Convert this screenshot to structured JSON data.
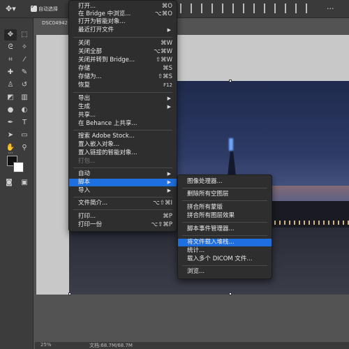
{
  "options_bar": {
    "auto_select_label": "自动选择"
  },
  "document": {
    "tab_title": "DSC04942"
  },
  "status": {
    "zoom": "25%",
    "doc_size": "文档:68.7M/68.7M"
  },
  "file_menu": {
    "items": [
      {
        "label": "打开...",
        "shortcut": "⌘O"
      },
      {
        "label": "在 Bridge 中浏览...",
        "shortcut": "⌥⌘O"
      },
      {
        "label": "打开为智能对象...",
        "shortcut": ""
      },
      {
        "label": "最近打开文件",
        "shortcut": ""
      },
      {
        "label": "关闭",
        "shortcut": "⌘W"
      },
      {
        "label": "关闭全部",
        "shortcut": "⌥⌘W"
      },
      {
        "label": "关闭并转到 Bridge...",
        "shortcut": "⇧⌘W"
      },
      {
        "label": "存储",
        "shortcut": "⌘S"
      },
      {
        "label": "存储为...",
        "shortcut": "⇧⌘S"
      },
      {
        "label": "恢复",
        "shortcut": "F12"
      },
      {
        "label": "导出",
        "shortcut": ""
      },
      {
        "label": "生成",
        "shortcut": ""
      },
      {
        "label": "共享...",
        "shortcut": ""
      },
      {
        "label": "在 Behance 上共享...",
        "shortcut": ""
      },
      {
        "label": "搜索 Adobe Stock...",
        "shortcut": ""
      },
      {
        "label": "置入嵌入对象...",
        "shortcut": ""
      },
      {
        "label": "置入链接的智能对象...",
        "shortcut": ""
      },
      {
        "label": "打包...",
        "shortcut": ""
      },
      {
        "label": "自动",
        "shortcut": ""
      },
      {
        "label": "脚本",
        "shortcut": ""
      },
      {
        "label": "导入",
        "shortcut": ""
      },
      {
        "label": "文件简介...",
        "shortcut": "⌥⇧⌘I"
      },
      {
        "label": "打印...",
        "shortcut": "⌘P"
      },
      {
        "label": "打印一份",
        "shortcut": "⌥⇧⌘P"
      }
    ]
  },
  "scripts_menu": {
    "items": [
      {
        "label": "图像处理器..."
      },
      {
        "label": "删除所有空图层"
      },
      {
        "label": "拼合所有蒙版"
      },
      {
        "label": "拼合所有图层效果"
      },
      {
        "label": "脚本事件管理器..."
      },
      {
        "label": "将文件载入堆栈..."
      },
      {
        "label": "统计..."
      },
      {
        "label": "载入多个 DICOM 文件..."
      },
      {
        "label": "浏览..."
      }
    ]
  },
  "colors": {
    "highlight": "#1e6fe0",
    "menu_bg": "#2e2e2e"
  }
}
